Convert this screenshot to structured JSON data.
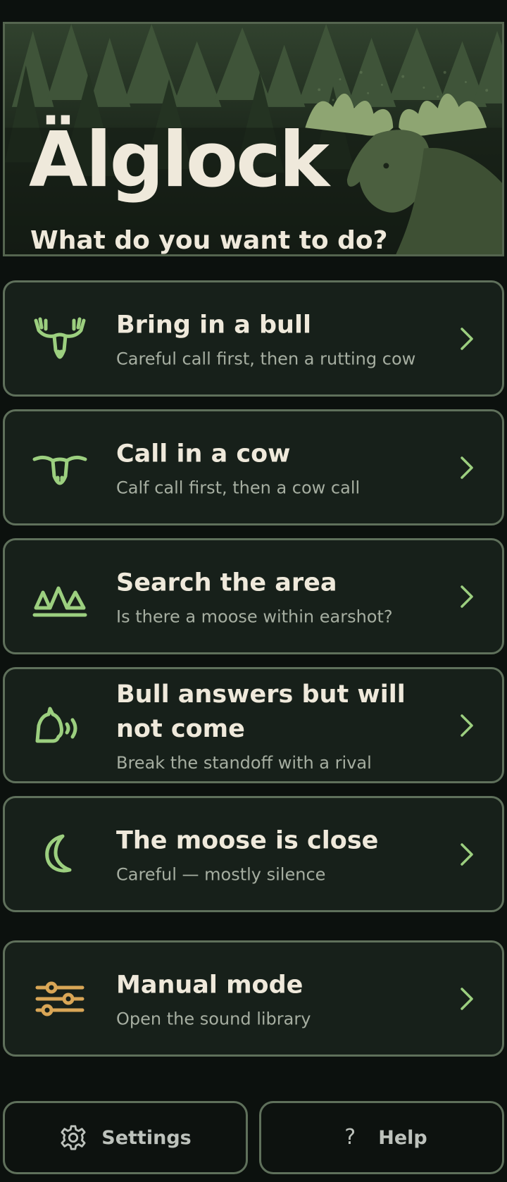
{
  "header": {
    "title": "Älglock",
    "subtitle": "What do you want to do?"
  },
  "actions": [
    {
      "icon": "moose-bull-icon",
      "title": "Bring in a bull",
      "subtitle": "Careful call first, then a rutting cow"
    },
    {
      "icon": "moose-cow-icon",
      "title": "Call in a cow",
      "subtitle": "Calf call first, then a cow call"
    },
    {
      "icon": "forest-icon",
      "title": "Search the area",
      "subtitle": "Is there a moose within earshot?"
    },
    {
      "icon": "calling-moose-icon",
      "title": "Bull answers but will not come",
      "subtitle": "Break the standoff with a rival"
    },
    {
      "icon": "moon-icon",
      "title": "The moose is close",
      "subtitle": "Careful — mostly silence"
    }
  ],
  "manual": {
    "icon": "sliders-icon",
    "title": "Manual mode",
    "subtitle": "Open the sound library"
  },
  "footer": {
    "settings_label": "Settings",
    "settings_icon": "gear-icon",
    "help_label": "Help",
    "help_icon": "question-icon",
    "help_glyph": "?"
  },
  "colors": {
    "background": "#0c110e",
    "card": "#17201a",
    "border": "#5f705b",
    "accent_green": "#9ccf7f",
    "accent_gold": "#d9a656",
    "text": "#efe9db",
    "muted": "#a6aea1"
  }
}
